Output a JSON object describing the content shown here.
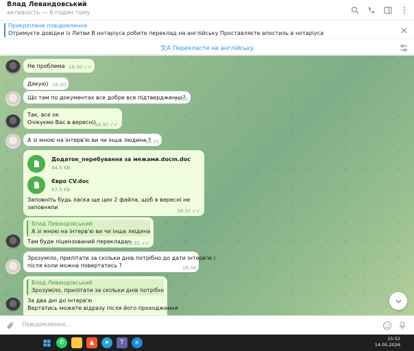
{
  "header": {
    "name": "Влад Левандовський",
    "status": "активність — 6 годин тому"
  },
  "pinned": {
    "title": "Прикріплене повідомлення",
    "text": "Отримуєте довідки із Литви В нотаріуса робите переклад на англійську  Проставляєте апостиль в нотаріуса"
  },
  "translate": {
    "label": "Перекласти на англійську"
  },
  "messages": [
    {
      "text": "Не проблема",
      "time": "16:30"
    },
    {
      "text": "Дякую)",
      "time": "16:30"
    },
    {
      "text": "Що там по документах все добре все підтвердженно?",
      "time": "16:30"
    },
    {
      "line1": "Так, все ок",
      "line2": "Очікуємо Вас в вересні)",
      "time": "16:30"
    },
    {
      "text": "А зі мною на інтерв'ю ви чи інша людина ?",
      "time": "16:31"
    },
    {
      "file1_name": "Додаток_перебування за межами.docm.doc",
      "file1_size": "44.5 KB",
      "file2_name": "Євро CV.doc",
      "file2_size": "87.5 KB",
      "line1": "Заповніть будь ласка ще цих 2 файла, щоб в вересні не",
      "line2": "заповняли",
      "time": "16:31"
    },
    {
      "quote_name": "Влад Левандовський",
      "quote_text": "А зі мною на інтерв'ю ви чи інша людина ?",
      "text": "Там буде ліцензований перекладач",
      "time": "16:31"
    },
    {
      "line1": "Зрозуміло, прилітати за скільки днів потрібно до дати інтерв'ю і",
      "line2": "після коли можна повертатись ?",
      "time": "16:34"
    },
    {
      "quote_name": "Влад Левандовський",
      "quote_text": "Зрозуміло, прилітати за скільки днів потрібно ...",
      "line1": "За два дні до інтерв'ю",
      "line2": "Вертатись можете відразу після його проходження"
    }
  ],
  "input": {
    "placeholder": "Повідомлення..."
  },
  "taskbar": {
    "time": "15:52",
    "date": "14.05.2026"
  },
  "colors": {
    "accent": "#3390ec",
    "outgoing": "#effdde",
    "check": "#4fae4e"
  }
}
